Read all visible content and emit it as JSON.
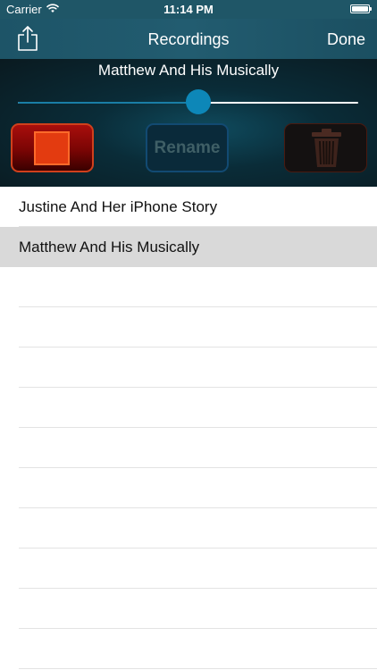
{
  "status_bar": {
    "carrier": "Carrier",
    "time": "11:14 PM",
    "battery_level": 1.0
  },
  "nav": {
    "title": "Recordings",
    "done_label": "Done"
  },
  "player": {
    "now_playing": "Matthew And His Musically",
    "progress": 0.53,
    "rename_label": "Rename"
  },
  "recordings": [
    {
      "name": "Justine And Her iPhone Story",
      "selected": false
    },
    {
      "name": "Matthew And His Musically",
      "selected": true
    }
  ],
  "colors": {
    "nav_bar": "#225c70",
    "slider_thumb": "#0d87b8",
    "stop_button": "#a80e0c",
    "selected_row": "#d9d9d9"
  },
  "icons": {
    "share": "share-icon",
    "stop": "stop-icon",
    "trash": "trash-icon",
    "wifi": "wifi-icon",
    "battery": "battery-icon"
  }
}
